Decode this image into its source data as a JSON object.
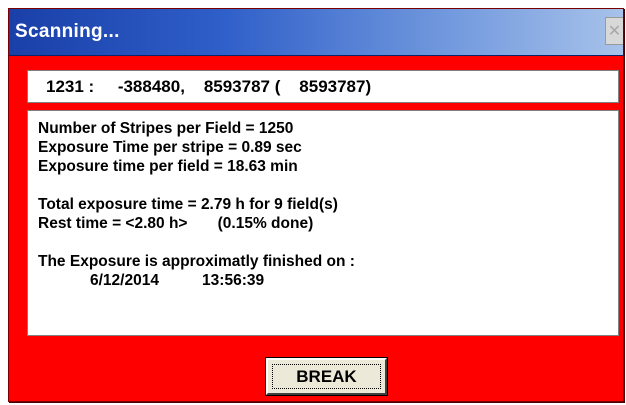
{
  "window": {
    "title": "Scanning...",
    "close_icon": "close-icon",
    "colors": {
      "background": "#ff0000",
      "titlebar_start": "#1a3fa8",
      "titlebar_end": "#a7c2ea"
    }
  },
  "status": {
    "coordinates": "1231 :     -388480,    8593787 (    8593787)"
  },
  "info": {
    "stripes_per_field": "Number of Stripes per Field = 1250",
    "exposure_per_stripe": "Exposure Time per stripe = 0.89 sec",
    "exposure_per_field": "Exposure time per field = 18.63 min",
    "total_exposure": "Total exposure time = 2.79 h for 9 field(s)",
    "rest_time": "Rest time = <2.80 h>       (0.15% done)",
    "finish_label": "The Exposure is approximatly finished on :",
    "finish_date": "6/12/2014",
    "finish_time": "13:56:39"
  },
  "buttons": {
    "break_label": "BREAK"
  }
}
